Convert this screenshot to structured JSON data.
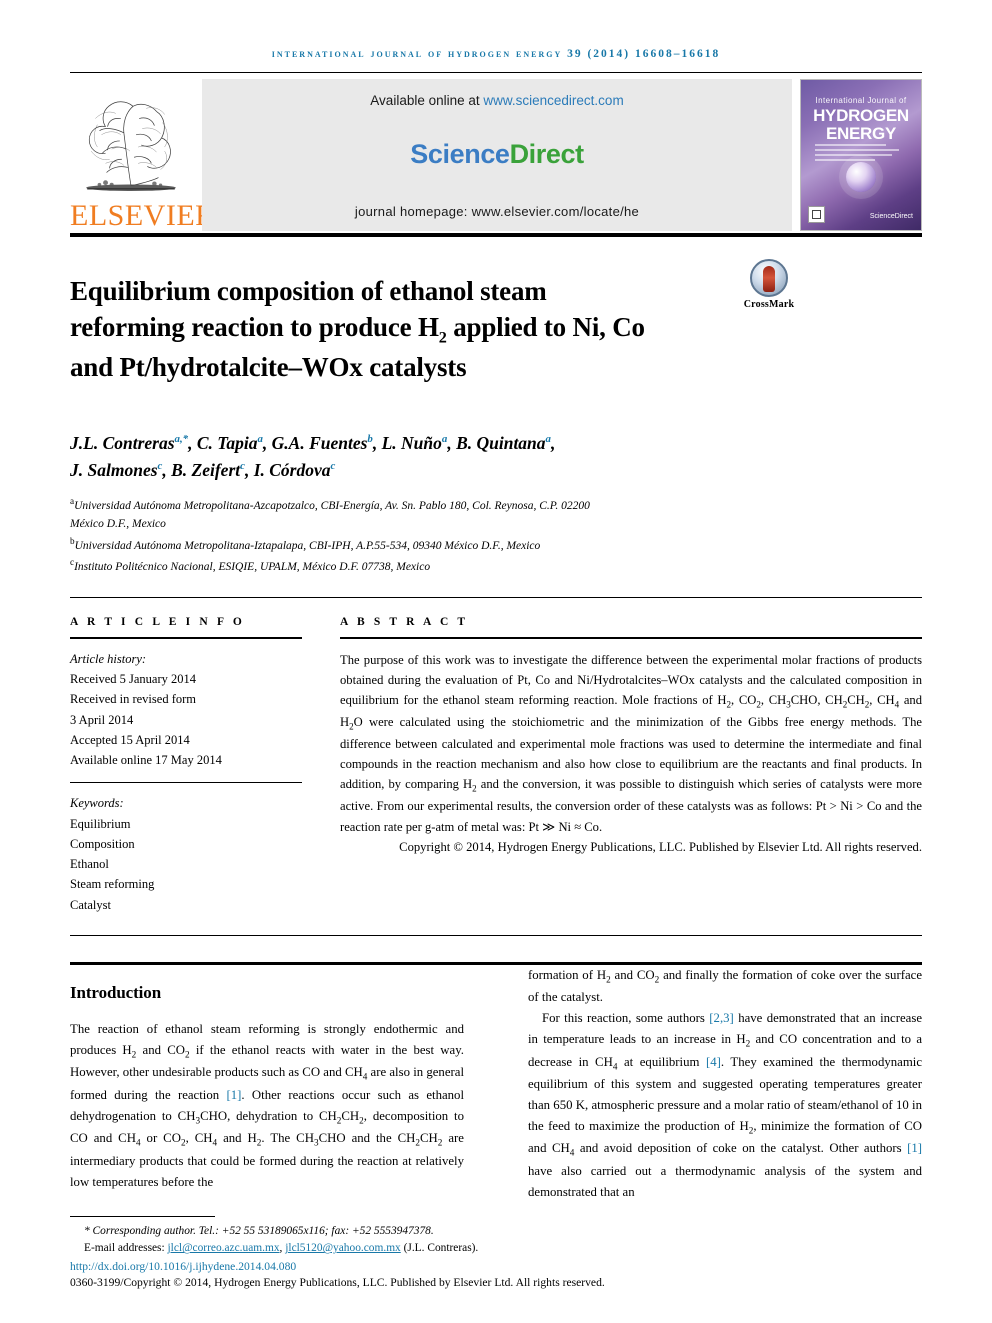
{
  "running_head": "International Journal of Hydrogen Energy 39 (2014) 16608–16618",
  "masthead": {
    "publisher_logo_name": "ELSEVIER",
    "available_prefix": "Available online at ",
    "available_url": "www.sciencedirect.com",
    "sciencedirect_science": "Science",
    "sciencedirect_direct": "Direct",
    "journal_homepage": "journal homepage: www.elsevier.com/locate/he",
    "cover": {
      "line1": "International Journal of",
      "line2": "HYDROGEN",
      "line3": "ENERGY",
      "sciencedirect_mark": "ScienceDirect"
    }
  },
  "article": {
    "title_line1": "Equilibrium composition of ethanol steam",
    "title_line2_a": "reforming reaction to produce H",
    "title_line2_sub": "2",
    "title_line2_b": " applied to Ni, Co",
    "title_line3": "and Pt/hydrotalcite–WOx catalysts",
    "crossmark_label": "CrossMark",
    "authors_line1": "J.L. Contreras",
    "authors_line2": "J. Salmones",
    "authors_full_1": "J.L. Contreras a,*, C. Tapia a, G.A. Fuentes b, L. Nuño a, B. Quintana a,",
    "authors_full_2": "J. Salmones c, B. Zeifert c, I. Córdova c",
    "affiliations": [
      "a Universidad Autónoma Metropolitana-Azcapotzalco, CBI-Energía, Av. Sn. Pablo 180, Col. Reynosa, C.P. 02200 México D.F., Mexico",
      "b Universidad Autónoma Metropolitana-Iztapalapa, CBI-IPH, A.P.55-534, 09340 México D.F., Mexico",
      "c Instituto Politécnico Nacional, ESIQIE, UPALM, México D.F. 07738, Mexico"
    ],
    "affil_a_l1": "Universidad Autónoma Metropolitana-Azcapotzalco, CBI-Energía, Av. Sn. Pablo 180, Col. Reynosa, C.P. 02200",
    "affil_a_l2": "México D.F., Mexico",
    "affil_b": "Universidad Autónoma Metropolitana-Iztapalapa, CBI-IPH, A.P.55-534, 09340 México D.F., Mexico",
    "affil_c": "Instituto Politécnico Nacional, ESIQIE, UPALM, México D.F. 07738, Mexico"
  },
  "article_info": {
    "heading": "A R T I C L E   I N F O",
    "history_label": "Article history:",
    "history": [
      "Received 5 January 2014",
      "Received in revised form",
      "3 April 2014",
      "Accepted 15 April 2014",
      "Available online 17 May 2014"
    ],
    "keywords_label": "Keywords:",
    "keywords": [
      "Equilibrium",
      "Composition",
      "Ethanol",
      "Steam reforming",
      "Catalyst"
    ]
  },
  "abstract": {
    "heading": "A B S T R A C T",
    "text": "The purpose of this work was to investigate the difference between the experimental molar fractions of products obtained during the evaluation of Pt, Co and Ni/Hydrotalcites–WOx catalysts and the calculated composition in equilibrium for the ethanol steam reforming reaction. Mole fractions of H2, CO2, CH3CHO, CH2CH2, CH4 and H2O were calculated using the stoichiometric and the minimization of the Gibbs free energy methods. The difference between calculated and experimental mole fractions was used to determine the intermediate and final compounds in the reaction mechanism and also how close to equilibrium are the reactants and final products. In addition, by comparing H2 and the conversion, it was possible to distinguish which series of catalysts were more active. From our experimental results, the conversion order of these catalysts was as follows: Pt > Ni > Co and the reaction rate per g-atm of metal was: Pt ≫ Ni ≈ Co.",
    "copyright": "Copyright © 2014, Hydrogen Energy Publications, LLC. Published by Elsevier Ltd. All rights reserved."
  },
  "introduction": {
    "heading": "Introduction",
    "left_paragraph": "The reaction of ethanol steam reforming is strongly endothermic and produces H2 and CO2 if the ethanol reacts with water in the best way. However, other undesirable products such as CO and CH4 are also in general formed during the reaction [1]. Other reactions occur such as ethanol dehydrogenation to CH3CHO, dehydration to CH2CH2, decomposition to CO and CH4 or CO2, CH4 and H2. The CH3CHO and the CH2CH2 are intermediary products that could be formed during the reaction at relatively low temperatures before the",
    "right_paragraph_1": "formation of H2 and CO2 and finally the formation of coke over the surface of the catalyst.",
    "right_paragraph_2": "For this reaction, some authors [2,3] have demonstrated that an increase in temperature leads to an increase in H2 and CO concentration and to a decrease in CH4 at equilibrium [4]. They examined the thermodynamic equilibrium of this system and suggested operating temperatures greater than 650 K, atmospheric pressure and a molar ratio of steam/ethanol of 10 in the feed to maximize the production of H2, minimize the formation of CO and CH4 and avoid deposition of coke on the catalyst. Other authors [1] have also carried out a thermodynamic analysis of the system and demonstrated that an"
  },
  "footnote": {
    "corresponding": "Corresponding author. Tel.: +52 55 53189065x116; fax: +52 5553947378.",
    "email_label": "E-mail addresses: ",
    "email1": "jlcl@correo.azc.uam.mx",
    "email_sep": ", ",
    "email2": "jlcl5120@yahoo.com.mx",
    "email_suffix": " (J.L. Contreras).",
    "doi": "http://dx.doi.org/10.1016/j.ijhydene.2014.04.080",
    "copyright_line": "0360-3199/Copyright © 2014, Hydrogen Energy Publications, LLC. Published by Elsevier Ltd. All rights reserved."
  },
  "colors": {
    "link_blue": "#1878a8",
    "elsevier_orange": "#f07d21",
    "sciencedirect_green": "#3aa23a",
    "sciencedirect_blue": "#3b7dc4"
  }
}
